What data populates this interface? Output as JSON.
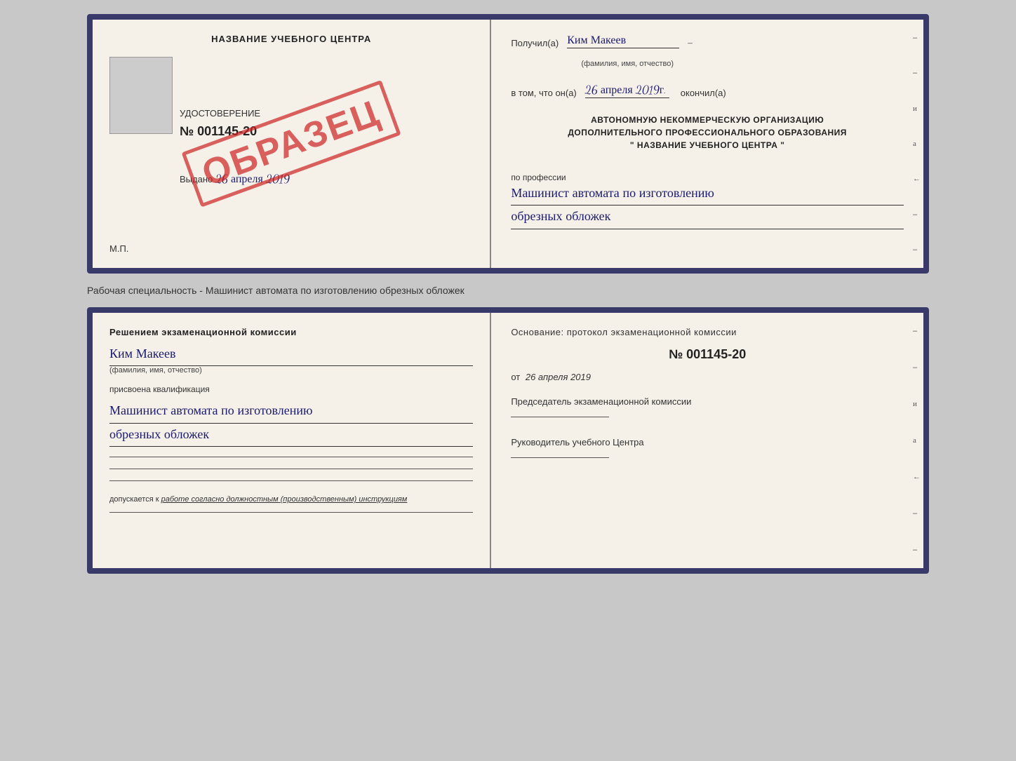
{
  "top_cert": {
    "left": {
      "title": "НАЗВАНИЕ УЧЕБНОГО ЦЕНТРА",
      "cert_label": "УДОСТОВЕРЕНИЕ",
      "cert_number": "№ 001145-20",
      "issued_label": "Выдано",
      "issued_date": "26 апреля 2019",
      "mp_label": "М.П.",
      "stamp_text": "ОБРАЗЕЦ"
    },
    "right": {
      "received_label": "Получил(а)",
      "received_name": "Ким Макеев",
      "name_sub": "(фамилия, имя, отчество)",
      "date_label": "в том, что он(а)",
      "date_value": "26 апреля 2019г.",
      "completed_label": "окончил(а)",
      "org_line1": "АВТОНОМНУЮ НЕКОММЕРЧЕСКУЮ ОРГАНИЗАЦИЮ",
      "org_line2": "ДОПОЛНИТЕЛЬНОГО ПРОФЕССИОНАЛЬНОГО ОБРАЗОВАНИЯ",
      "org_line3": "\"  НАЗВАНИЕ УЧЕБНОГО ЦЕНТРА  \"",
      "profession_label": "по профессии",
      "profession_line1": "Машинист автомата по изготовлению",
      "profession_line2": "обрезных обложек"
    }
  },
  "separator": {
    "text": "Рабочая специальность - Машинист автомата по изготовлению обрезных обложек"
  },
  "bottom_qual": {
    "left": {
      "heading": "Решением экзаменационной комиссии",
      "name": "Ким Макеев",
      "name_sub": "(фамилия, имя, отчество)",
      "assigned_label": "присвоена квалификация",
      "profession_line1": "Машинист автомата по изготовлению",
      "profession_line2": "обрезных обложек",
      "допуск_prefix": "допускается к ",
      "допуск_italic": "работе согласно должностным (производственным) инструкциям"
    },
    "right": {
      "basis_label": "Основание: протокол экзаменационной комиссии",
      "protocol_num": "№ 001145-20",
      "date_prefix": "от",
      "date_value": "26 апреля 2019",
      "chairman_label": "Председатель экзаменационной комиссии",
      "director_label": "Руководитель учебного Центра"
    }
  },
  "side_deco": [
    "и",
    "а",
    "←",
    "–",
    "–",
    "–",
    "–"
  ],
  "side_deco2": [
    "и",
    "а",
    "←",
    "–",
    "–",
    "–",
    "–"
  ]
}
